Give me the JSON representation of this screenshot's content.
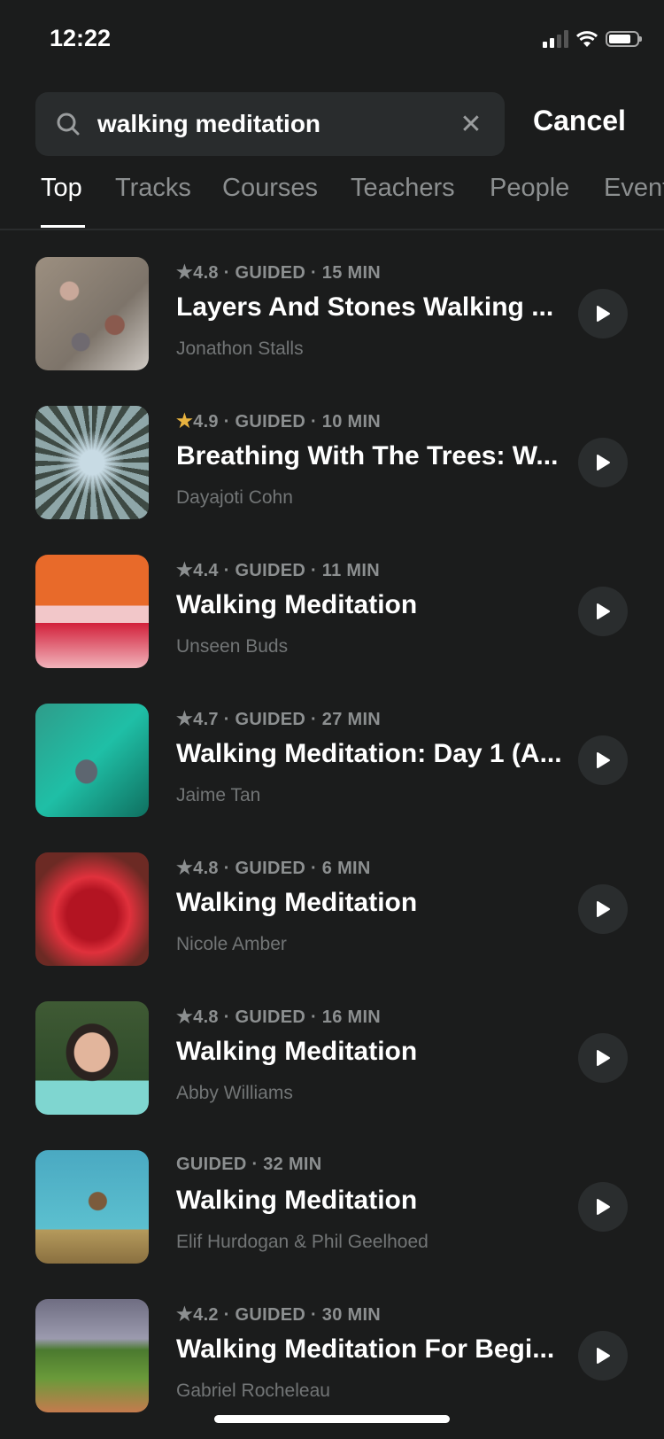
{
  "status": {
    "time": "12:22"
  },
  "search": {
    "value": "walking meditation",
    "cancel_label": "Cancel"
  },
  "tabs": [
    {
      "label": "Top",
      "active": true
    },
    {
      "label": "Tracks"
    },
    {
      "label": "Courses"
    },
    {
      "label": "Teachers"
    },
    {
      "label": "People"
    },
    {
      "label": "Events"
    }
  ],
  "colors": {
    "star_default": "#8c8f90",
    "star_highlight": "#e9b33f",
    "background": "#1b1c1c"
  },
  "results": [
    {
      "rating": "4.8",
      "meta": "GUIDED · 15 MIN",
      "title": "Layers And Stones Walking ...",
      "author": "Jonathon Stalls",
      "star": "gray",
      "thumb": "stones"
    },
    {
      "rating": "4.9",
      "meta": "GUIDED · 10 MIN",
      "title": "Breathing With The Trees: W...",
      "author": "Dayajoti Cohn",
      "star": "gold",
      "thumb": "trees"
    },
    {
      "rating": "4.4",
      "meta": "GUIDED · 11 MIN",
      "title": "Walking Meditation",
      "author": "Unseen Buds",
      "star": "gray",
      "thumb": "petals"
    },
    {
      "rating": "4.7",
      "meta": "GUIDED · 27 MIN",
      "title": "Walking Meditation: Day 1 (A...",
      "author": "Jaime Tan",
      "star": "gray",
      "thumb": "teal-wall"
    },
    {
      "rating": "4.8",
      "meta": "GUIDED · 6 MIN",
      "title": "Walking Meditation",
      "author": "Nicole Amber",
      "star": "gray",
      "thumb": "red-flower"
    },
    {
      "rating": "4.8",
      "meta": "GUIDED · 16 MIN",
      "title": "Walking Meditation",
      "author": "Abby Williams",
      "star": "gray",
      "thumb": "portrait"
    },
    {
      "rating": null,
      "meta": "GUIDED · 32 MIN",
      "title": "Walking Meditation",
      "author": "Elif Hurdogan & Phil Geelhoed",
      "star": null,
      "thumb": "dancer"
    },
    {
      "rating": "4.2",
      "meta": "GUIDED · 30 MIN",
      "title": "Walking Meditation For Begi...",
      "author": "Gabriel Rocheleau",
      "star": "gray",
      "thumb": "hill-path"
    }
  ]
}
